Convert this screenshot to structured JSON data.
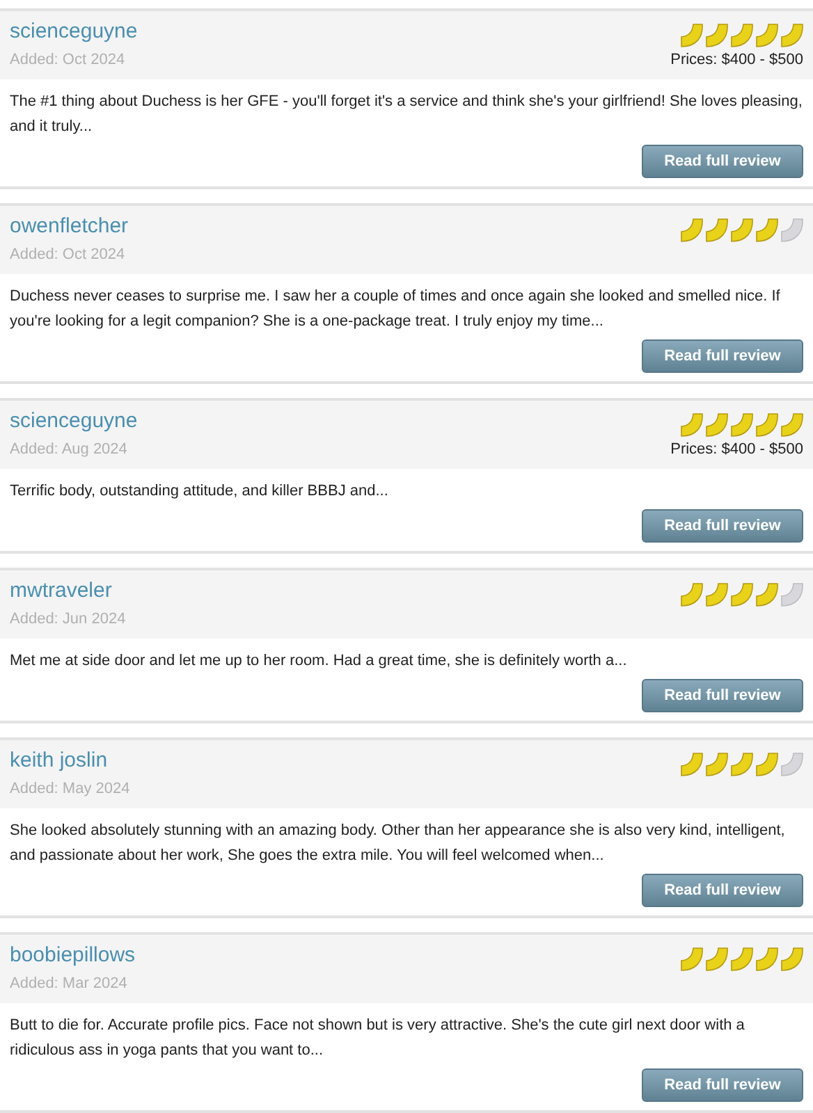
{
  "reviews": [
    {
      "author": "scienceguyne",
      "added": "Added: Oct 2024",
      "stars": 5,
      "prices": "Prices: $400 - $500",
      "text": "The #1 thing about Duchess is her GFE - you'll forget it's a service and think she's your girlfriend! She loves pleasing, and it truly...",
      "button": "Read full review"
    },
    {
      "author": "owenfletcher",
      "added": "Added: Oct 2024",
      "stars": 4,
      "text": "Duchess never ceases to surprise me. I saw her a couple of times and once again she looked and smelled nice. If you're looking for a legit companion? She is a one-package treat. I truly enjoy my time...",
      "button": "Read full review"
    },
    {
      "author": "scienceguyne",
      "added": "Added: Aug 2024",
      "stars": 5,
      "prices": "Prices: $400 - $500",
      "text": "Terrific body, outstanding attitude, and killer BBBJ and...",
      "button": "Read full review"
    },
    {
      "author": "mwtraveler",
      "added": "Added: Jun 2024",
      "stars": 4,
      "text": "Met me at side door and let me up to her room. Had a great time, she is definitely worth a...",
      "button": "Read full review"
    },
    {
      "author": "keith joslin",
      "added": "Added: May 2024",
      "stars": 4,
      "text": "She looked absolutely stunning with an amazing body. Other than her appearance she is also very kind, intelligent, and passionate about her work, She goes the extra mile. You will feel welcomed when...",
      "button": "Read full review"
    },
    {
      "author": "boobiepillows",
      "added": "Added: Mar 2024",
      "stars": 5,
      "text": "Butt to die for. Accurate profile pics. Face not shown but is very attractive. She's the cute girl next door with a ridiculous ass in yoga pants that you want to...",
      "button": "Read full review"
    }
  ]
}
